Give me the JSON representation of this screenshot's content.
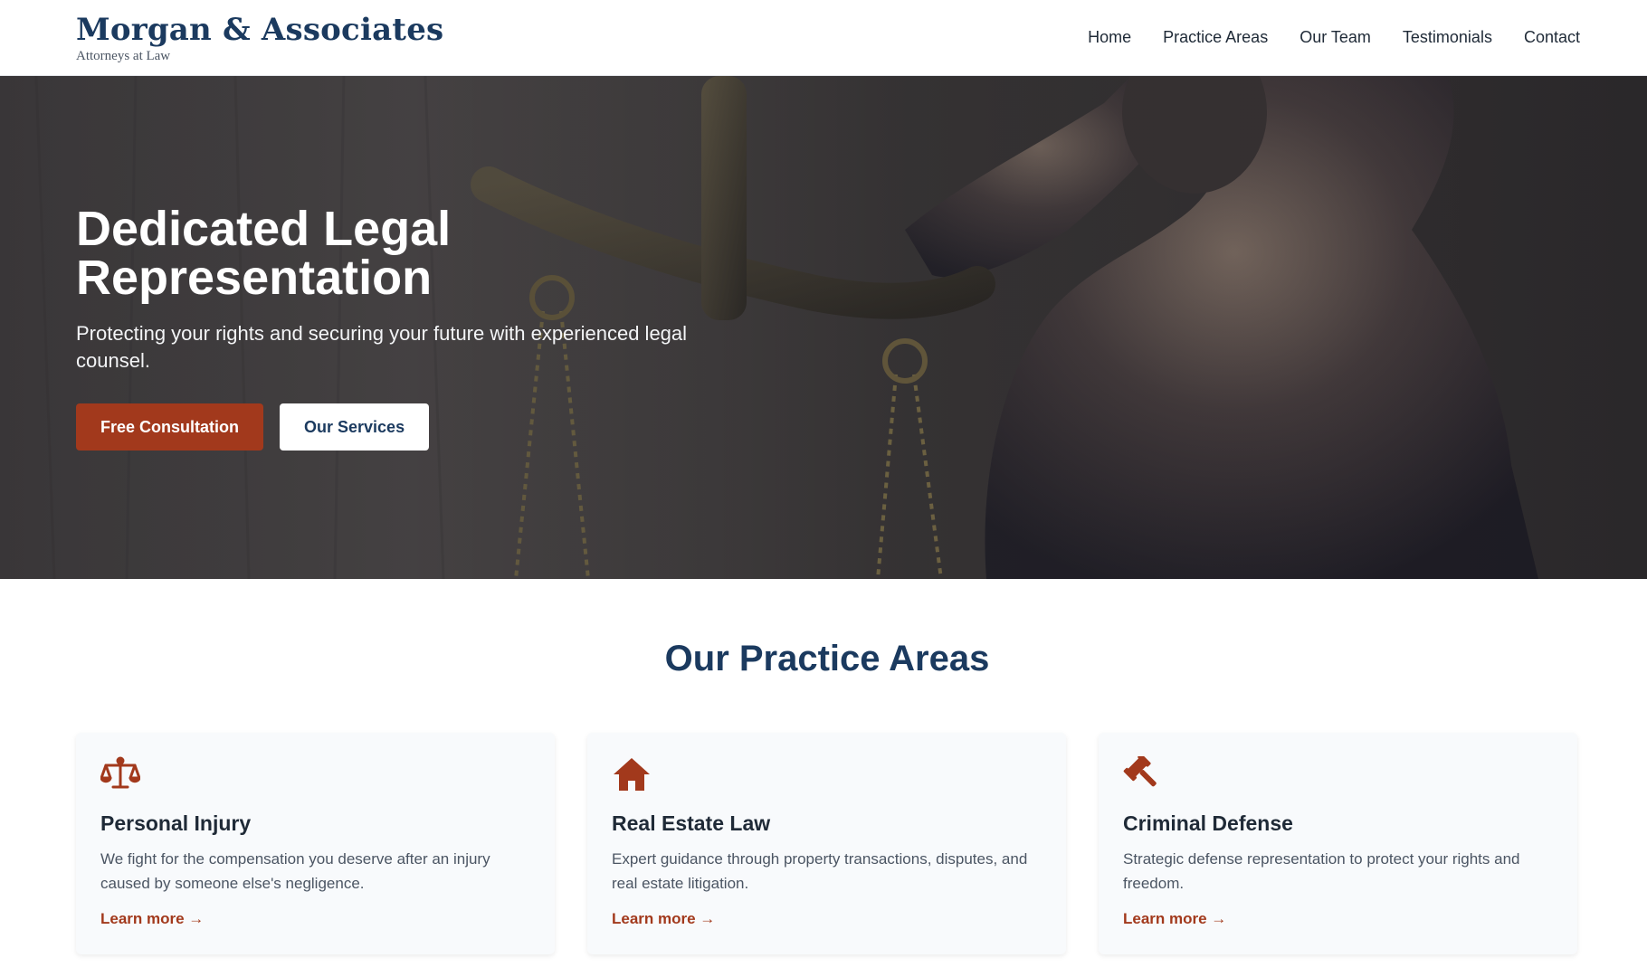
{
  "header": {
    "brand_name": "Morgan & Associates",
    "brand_tagline": "Attorneys at Law",
    "nav": [
      {
        "label": "Home"
      },
      {
        "label": "Practice Areas"
      },
      {
        "label": "Our Team"
      },
      {
        "label": "Testimonials"
      },
      {
        "label": "Contact"
      }
    ]
  },
  "hero": {
    "title": "Dedicated Legal Representation",
    "subtitle": "Protecting your rights and securing your future with experienced legal counsel.",
    "primary_button": "Free Consultation",
    "secondary_button": "Our Services"
  },
  "practice": {
    "title": "Our Practice Areas",
    "cards": [
      {
        "icon": "scales-icon",
        "title": "Personal Injury",
        "description": "We fight for the compensation you deserve after an injury caused by someone else's negligence.",
        "link": "Learn more →"
      },
      {
        "icon": "house-icon",
        "title": "Real Estate Law",
        "description": "Expert guidance through property transactions, disputes, and real estate litigation.",
        "link": "Learn more →"
      },
      {
        "icon": "gavel-icon",
        "title": "Criminal Defense",
        "description": "Strategic defense representation to protect your rights and freedom.",
        "link": "Learn more →"
      }
    ]
  },
  "colors": {
    "brand": "#1b3a5f",
    "accent": "#a2391c",
    "card_bg": "#f8fafc"
  }
}
